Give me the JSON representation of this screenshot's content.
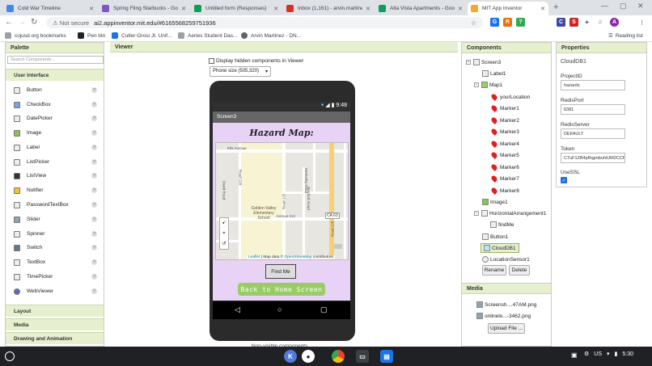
{
  "browser": {
    "tabs": [
      {
        "title": "Cold War Timeline",
        "color": "#4285f4",
        "glyph": "▤"
      },
      {
        "title": "Spring Fling Starbucks - Go",
        "color": "#7e57c2",
        "glyph": "▤"
      },
      {
        "title": "Untitled form (Responses)",
        "color": "#0f9d58",
        "glyph": "+"
      },
      {
        "title": "Inbox (1,161) - arvin.martinez",
        "color": "#d93025",
        "glyph": "M"
      },
      {
        "title": "Alta Vista Apartments - Goo",
        "color": "#0f9d58",
        "glyph": "▤"
      },
      {
        "title": "MIT App Inventor",
        "color": "#f9a825",
        "glyph": "✿"
      }
    ],
    "address": {
      "security": "Not secure",
      "url": "ai2.appinventor.mit.edu/#6165568259751936"
    },
    "extensions": [
      {
        "label": "G",
        "color": "#1a73e8"
      },
      {
        "label": "R",
        "color": "#e8710a"
      },
      {
        "label": "?",
        "color": "#34a853"
      }
    ],
    "bookmarks": [
      {
        "label": "cojusd.org bookmarks",
        "color": "#9aa0a6"
      },
      {
        "label": "Pen btn",
        "color": "#202124"
      },
      {
        "label": "Cutler-Orosi Jt. Unif...",
        "color": "#1a73e8"
      },
      {
        "label": "Aeries Student Das...",
        "color": "#9aa0a6"
      },
      {
        "label": "Arvin Martinez - DN...",
        "color": "#5f6368"
      }
    ],
    "reading_list": "Reading list"
  },
  "palette": {
    "header": "Palette",
    "search_placeholder": "Search Components...",
    "user_interface_label": "User Interface",
    "items": [
      {
        "label": "Button"
      },
      {
        "label": "CheckBox"
      },
      {
        "label": "DatePicker"
      },
      {
        "label": "Image"
      },
      {
        "label": "Label"
      },
      {
        "label": "ListPicker"
      },
      {
        "label": "ListView"
      },
      {
        "label": "Notifier"
      },
      {
        "label": "PasswordTextBox"
      },
      {
        "label": "Slider"
      },
      {
        "label": "Spinner"
      },
      {
        "label": "Switch"
      },
      {
        "label": "TextBox"
      },
      {
        "label": "TimePicker"
      },
      {
        "label": "WebViewer"
      }
    ],
    "help_glyph": "?",
    "categories": [
      "Layout",
      "Media",
      "Drawing and Animation"
    ]
  },
  "viewer": {
    "header": "Viewer",
    "hidden_components_label": "Display hidden components in Viewer",
    "phone_size": "Phone size (505,320)",
    "clock": "9:48",
    "screen_name": "Screen3",
    "title_label": "Hazard Map:",
    "map": {
      "streets": [
        "Ella Avenue",
        "Road 120",
        "David Road",
        "Road 125",
        "Avenue 414",
        "Wetherby Road",
        "Burdock Road",
        "CA 63",
        "Road 128"
      ],
      "school": "Golden Valley Elementary School",
      "attribution_link_1": "Leaflet",
      "attribution_mid": " | Map data © ",
      "attribution_link_2": "OpenStreetMap",
      "attribution_end": " contributors"
    },
    "find_me": "Find Me",
    "back_home": "Back to Home Screen",
    "non_visible": "Non-visible components"
  },
  "components": {
    "header": "Components",
    "tree": [
      {
        "label": "Screen3",
        "type": "screen"
      },
      {
        "label": "Label1",
        "type": "label"
      },
      {
        "label": "Map1",
        "type": "map"
      },
      {
        "label": "yourLocation",
        "type": "marker"
      },
      {
        "label": "Marker1",
        "type": "marker"
      },
      {
        "label": "Marker2",
        "type": "marker"
      },
      {
        "label": "Marker3",
        "type": "marker"
      },
      {
        "label": "Marker4",
        "type": "marker"
      },
      {
        "label": "Marker5",
        "type": "marker"
      },
      {
        "label": "Marker6",
        "type": "marker"
      },
      {
        "label": "Marker7",
        "type": "marker"
      },
      {
        "label": "Marker8",
        "type": "marker"
      },
      {
        "label": "Image1",
        "type": "image"
      },
      {
        "label": "HorizontalArrangement1",
        "type": "arrangement"
      },
      {
        "label": "findMe",
        "type": "button"
      },
      {
        "label": "Button1",
        "type": "button"
      },
      {
        "label": "CloudDB1",
        "type": "clouddb",
        "selected": true
      },
      {
        "label": "LocationSensor1",
        "type": "sensor"
      }
    ],
    "rename": "Rename",
    "delete": "Delete"
  },
  "media": {
    "header": "Media",
    "files": [
      "Screensh....47AM.png",
      "onlinelo...-3462.png"
    ],
    "upload": "Upload File ..."
  },
  "properties": {
    "header": "Properties",
    "component": "CloudDB1",
    "fields": [
      {
        "label": "ProjectID",
        "value": "hazards"
      },
      {
        "label": "RedisPort",
        "value": "6381"
      },
      {
        "label": "RedisServer",
        "value": "DEFAULT"
      },
      {
        "label": "Token",
        "value": "C7uF1ZB4pRqpobuhiUM2CCRt"
      }
    ],
    "use_ssl_label": "UseSSL",
    "use_ssl": true
  },
  "taskbar": {
    "locale": "US",
    "time": "5:30"
  }
}
